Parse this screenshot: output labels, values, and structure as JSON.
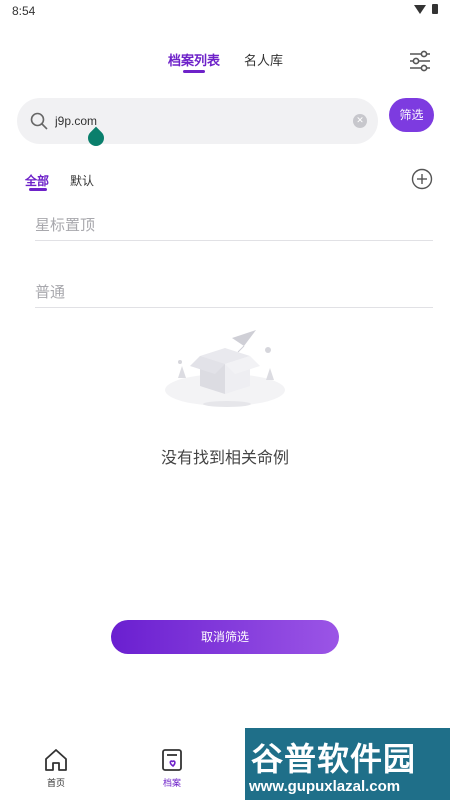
{
  "status_bar": {
    "time": "8:54"
  },
  "header": {
    "tabs": [
      {
        "label": "档案列表",
        "active": true
      },
      {
        "label": "名人库",
        "active": false
      }
    ]
  },
  "search": {
    "value": "j9p.com",
    "filter_label": "筛选"
  },
  "category_tabs": [
    {
      "label": "全部",
      "active": true
    },
    {
      "label": "默认",
      "active": false
    }
  ],
  "sections": {
    "starred": "星标置顶",
    "normal": "普通"
  },
  "empty_state": {
    "text": "没有找到相关命例"
  },
  "cancel_button": {
    "label": "取消筛选"
  },
  "bottom_nav": [
    {
      "label": "首页",
      "icon": "home-icon",
      "active": false
    },
    {
      "label": "档案",
      "icon": "archive-icon",
      "active": true
    }
  ],
  "watermark": {
    "cn": "谷普软件园",
    "url": "www.gupuxlazal.com"
  },
  "colors": {
    "accent": "#6e22c9",
    "filter_button": "#7d3be0",
    "search_bg": "#f1f1f3"
  }
}
